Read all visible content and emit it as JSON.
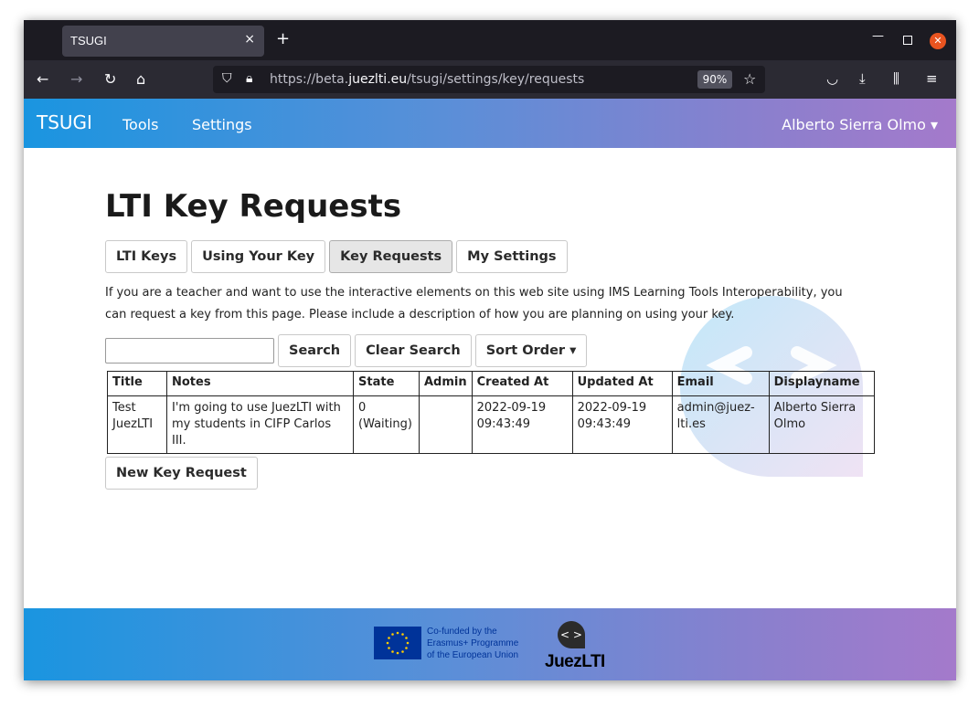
{
  "browser": {
    "tab_title": "TSUGI",
    "tab_close": "×",
    "new_tab": "+",
    "url_prefix": "https://beta.",
    "url_domain": "juezlti.eu",
    "url_path": "/tsugi/settings/key/requests",
    "zoom": "90%"
  },
  "header": {
    "brand": "TSUGI",
    "nav": [
      "Tools",
      "Settings"
    ],
    "user": "Alberto Sierra Olmo ▾"
  },
  "page": {
    "title": "LTI Key Requests",
    "tabs": [
      "LTI Keys",
      "Using Your Key",
      "Key Requests",
      "My Settings"
    ],
    "active_tab": "Key Requests",
    "intro": "If you are a teacher and want to use the interactive elements on this web site using IMS Learning Tools Interoperability, you can request a key from this page. Please include a description of how you are planning on using your key.",
    "search": {
      "value": "",
      "search_label": "Search",
      "clear_label": "Clear Search",
      "sort_label": "Sort Order ▾"
    },
    "table": {
      "headers": [
        "Title",
        "Notes",
        "State",
        "Admin",
        "Created At",
        "Updated At",
        "Email",
        "Displayname"
      ],
      "rows": [
        {
          "title": "Test JuezLTI",
          "notes": "I'm going to use JuezLTI with my students in CIFP Carlos III.",
          "state": "0 (Waiting)",
          "admin": "",
          "created_at": "2022-09-19 09:43:49",
          "updated_at": "2022-09-19 09:43:49",
          "email": "admin@juez-lti.es",
          "displayname": "Alberto Sierra Olmo"
        }
      ]
    },
    "new_key_label": "New Key Request"
  },
  "footer": {
    "eu_line1": "Co-funded by the",
    "eu_line2": "Erasmus+ Programme",
    "eu_line3": "of the European Union",
    "logo_symbol": "< >",
    "logo_juez": "Juez",
    "logo_lti": "LTI"
  },
  "colors": {
    "header_gradient_start": "#1a95e0",
    "header_gradient_end": "#a47acb",
    "eu_blue": "#003399",
    "eu_star": "#ffcc00"
  }
}
